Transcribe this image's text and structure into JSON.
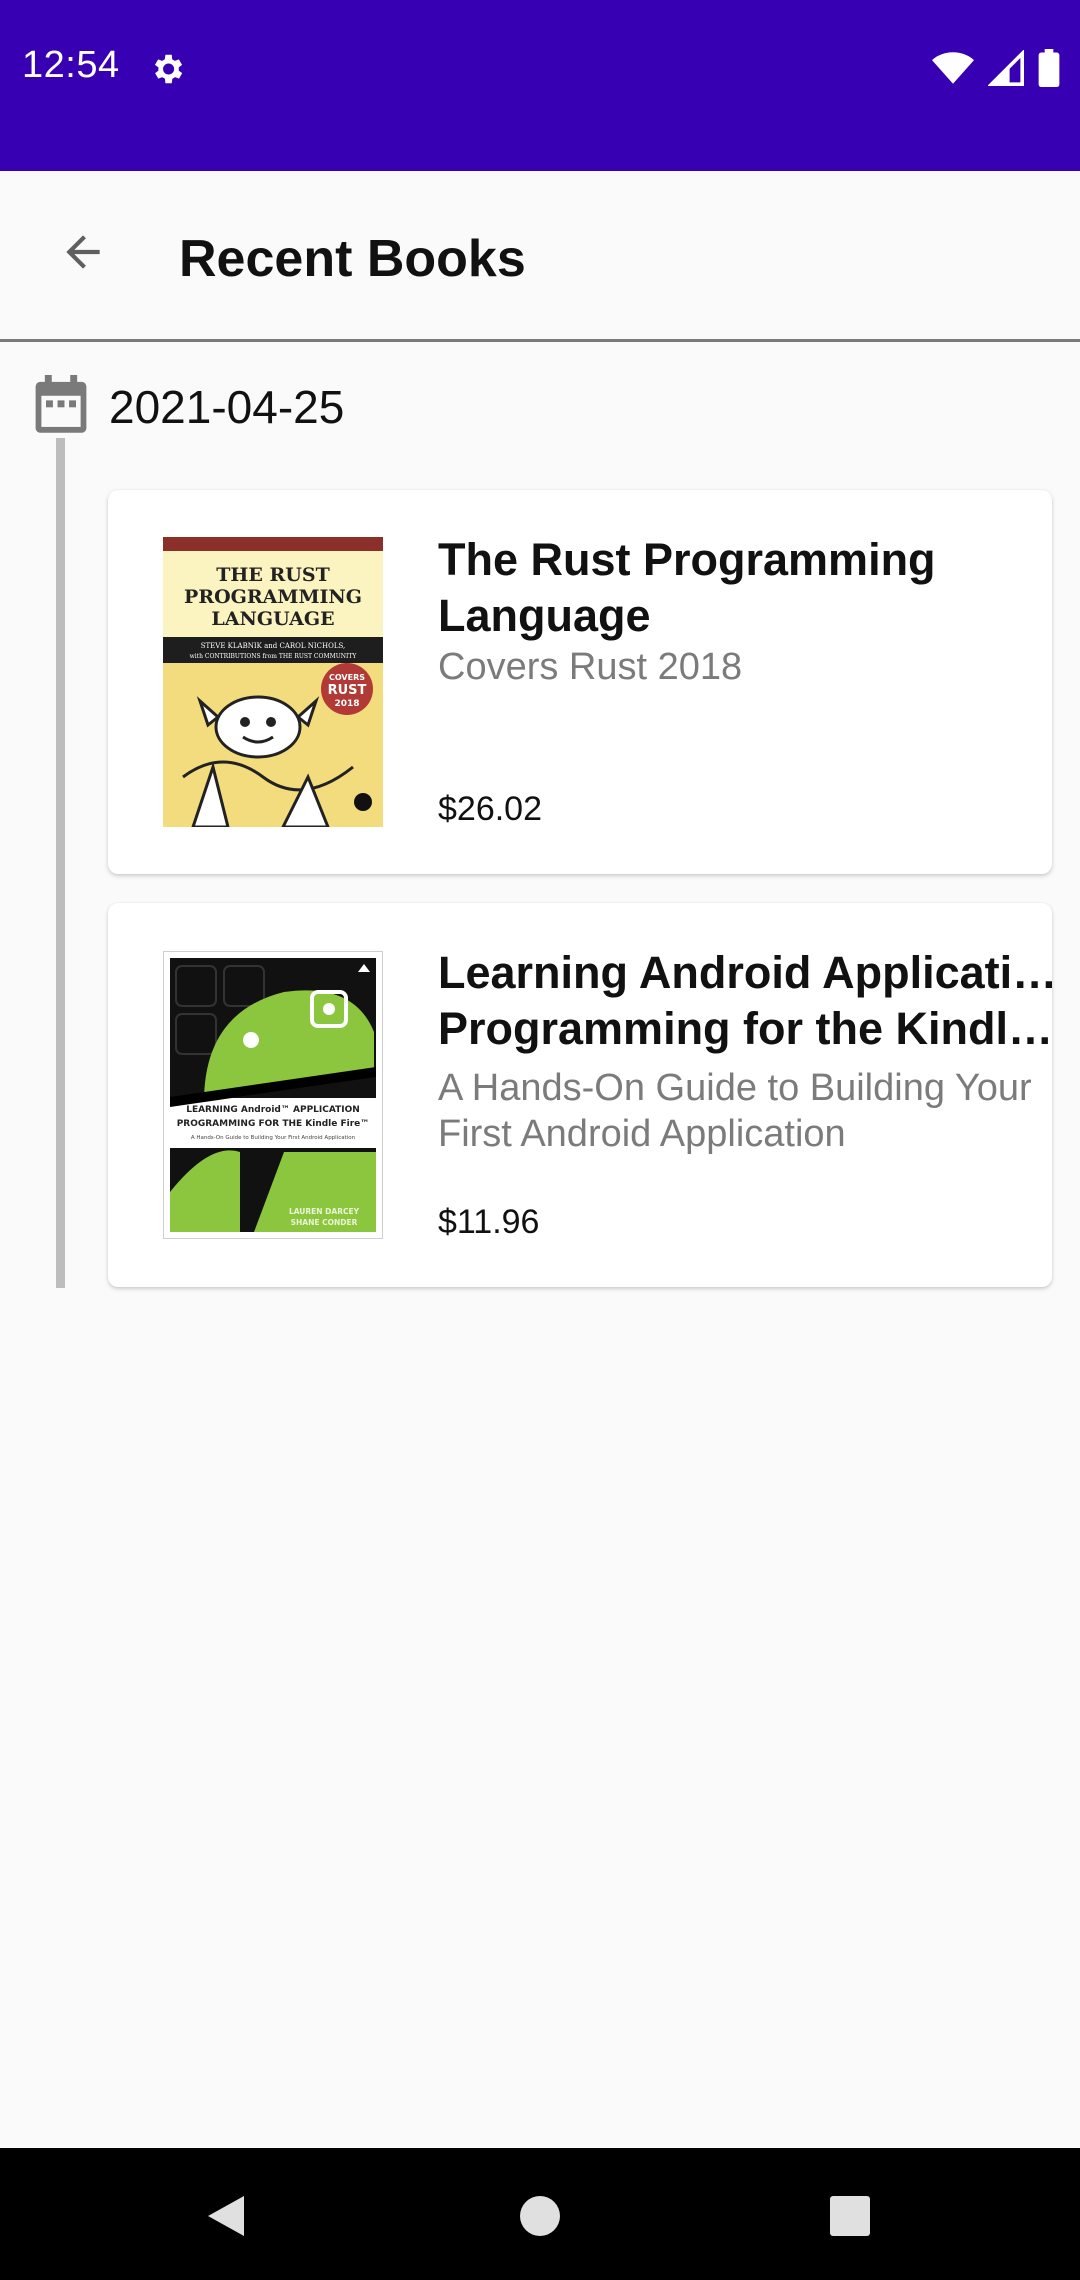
{
  "status_bar": {
    "time": "12:54",
    "background": "#3700b3"
  },
  "app_bar": {
    "title": "Recent Books",
    "back_icon": "arrow-back-icon"
  },
  "timeline": {
    "date": "2021-04-25",
    "date_icon": "calendar-icon"
  },
  "books": [
    {
      "title_line1": "The Rust Programming",
      "title_line2": "Language",
      "subtitle": "Covers Rust 2018",
      "price": "$26.02",
      "cover": {
        "title_lines": [
          "THE RUST",
          "PROGRAMMING",
          "LANGUAGE"
        ],
        "authors": "STEVE KLABNIK and CAROL NICHOLS,",
        "authors2": "with CONTRIBUTIONS from THE RUST COMMUNITY",
        "badge_top": "COVERS",
        "badge_mid": "RUST",
        "badge_bottom": "2018"
      }
    },
    {
      "title_line1": "Learning Android Application",
      "title_line2": "Programming for the Kindl…",
      "subtitle": "A Hands-On Guide to Building Your First Android Application",
      "price": "$11.96",
      "cover": {
        "line1": "LEARNING Android™ APPLICATION",
        "line2": "PROGRAMMING FOR THE Kindle Fire™",
        "tagline": "A Hands-On Guide to Building Your First Android Application",
        "author1": "LAUREN DARCEY",
        "author2": "SHANE CONDER"
      }
    }
  ],
  "nav_bar": {
    "back_icon": "nav-back-icon",
    "home_icon": "nav-home-icon",
    "recents_icon": "nav-recents-icon"
  }
}
